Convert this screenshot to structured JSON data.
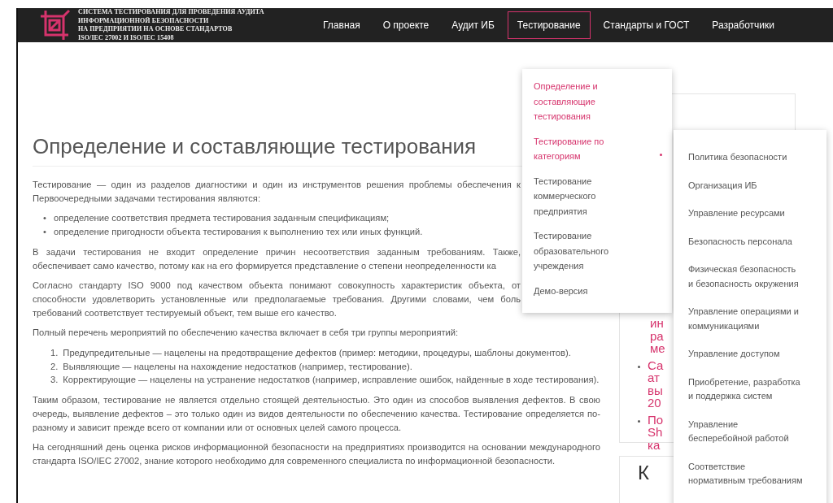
{
  "header": {
    "title": "СИСТЕМА ТЕСТИРОВАНИЯ ДЛЯ ПРОВЕДЕНИЯ АУДИТА\nИНФОРМАЦИОННОЙ БЕЗОПАСНОСТИ\nНА ПРЕДПРИЯТИИ НА ОСНОВЕ СТАНДАРТОВ\nISO/IEC 27002 И ISO/IEC 15408"
  },
  "nav": [
    {
      "label": "Главная",
      "selected": false
    },
    {
      "label": "О проекте",
      "selected": false
    },
    {
      "label": "Аудит ИБ",
      "selected": false
    },
    {
      "label": "Тестирование",
      "selected": true
    },
    {
      "label": "Стандарты и ГОСТ",
      "selected": false
    },
    {
      "label": "Разработчики",
      "selected": false
    }
  ],
  "dropdown": [
    {
      "label": "Определение и\nсоставляющие\nтестирования",
      "active": true,
      "expanded": false
    },
    {
      "label": "Тестирование по\nкатегориям",
      "active": true,
      "expanded": true
    },
    {
      "label": "Тестирование\nкоммерческого\nпредприятия",
      "active": false,
      "expanded": false
    },
    {
      "label": "Тестирование\nобразовательного\nучреждения",
      "active": false,
      "expanded": false
    },
    {
      "label": "Демо-версия",
      "active": false,
      "expanded": false
    }
  ],
  "submenu": [
    "Политика безопасности",
    "Организация ИБ",
    "Управление ресурсами",
    "Безопасность персонала",
    "Физическая безопасность\nи безопасность окружения",
    "Управление операциями и\nкоммуникациями",
    "Управление доступом",
    "Приобретение, разработка\nи поддержка систем",
    "Управление\nбесперебойной работой",
    "Соответствие\nнормативным требованиям"
  ],
  "article": {
    "heading": "Определение и составляющие тестирования",
    "blocks": [
      {
        "kind": "paragraph",
        "cut": true,
        "text": "Тестирование — один из разделов диагностики и один из инструментов решения проблемы обеспечения к Первоочередными задачами тестирования являются:"
      },
      {
        "kind": "bullets",
        "items": [
          {
            "marker": "•",
            "text": "определение соответствия предмета тестирования заданным спецификациям;"
          },
          {
            "marker": "•",
            "text": "определение пригодности объекта тестирования к выполнению тех или иных функций."
          }
        ]
      },
      {
        "kind": "paragraph",
        "cut": true,
        "text": "В задачи тестирования не входит определение причин несоответствия заданным требованиям. Также, обеспечивает само качество, потому как на его формируется представление о степени неопределенности ка"
      },
      {
        "kind": "paragraph",
        "cut": true,
        "text": "Согласно стандарту ISO 9000 под качеством объекта понимают совокупность характеристик объекта, от способности удовлетворить установленные или предполагаемые требования. Другими словами, чем боль требований соответствует тестируемый объект, тем выше его качество."
      },
      {
        "kind": "paragraph",
        "cut": false,
        "text": "Полный перечень мероприятий по обеспечению качества включает в себя три группы мероприятий:"
      },
      {
        "kind": "numbered",
        "items": [
          {
            "marker": "1.",
            "text": "Предупредительные — нацелены на предотвращение дефектов (пример: методики, процедуры, шаблоны документов)."
          },
          {
            "marker": "2.",
            "text": "Выявляющие — нацелены на нахождение недостатков (например, тестирование)."
          },
          {
            "marker": "3.",
            "text": "Корректирующие — нацелены на устранение недостатков (например, исправление ошибок, найденные в ходе тестирования)."
          }
        ]
      },
      {
        "kind": "paragraph",
        "cut": false,
        "text": "Таким образом, тестирование не является отдельно стоящей деятельностью. Это один из способов выявления дефектов. В свою очередь, выявление дефектов – это только один из видов деятельности по обеспечению качества. Тестирование определяется по-разному и зависит прежде всего от компании или от основных целей самого процесса."
      },
      {
        "kind": "paragraph",
        "cut": false,
        "text": "На сегодняшний день оценка рисков информационной безопасности на предприятиях производится на основании международного стандарта ISO/IEC 27002, знание которого необходимо для современного специалиста по информационной безопасности."
      }
    ]
  },
  "sidebar": {
    "links": [
      {
        "kind": "continued",
        "lines": [
          "ин",
          "ра",
          "ме"
        ]
      },
      {
        "kind": "item",
        "lines": [
          "Са",
          "ат",
          "вы",
          "20"
        ]
      },
      {
        "kind": "item",
        "lines": [
          "По",
          "Sh",
          "ка"
        ]
      }
    ],
    "next_heading": "К"
  }
}
